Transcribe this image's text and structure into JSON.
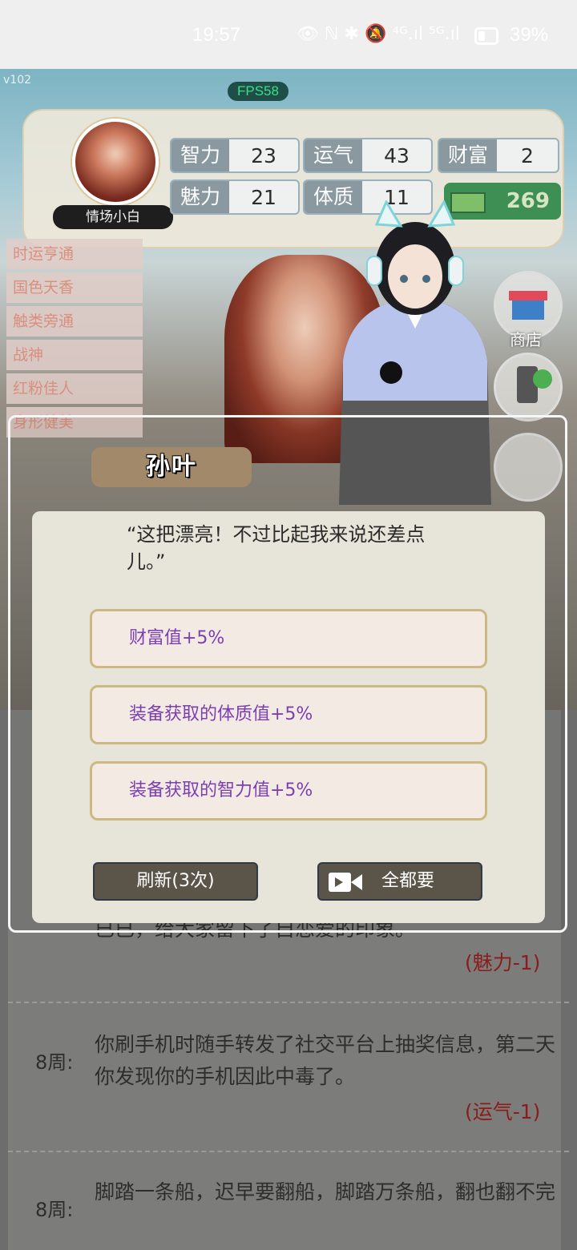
{
  "status_bar": {
    "time": "19:57",
    "icons_text": "👁 ℕ ✱ 🔕 ⁴ᴳ.ıl ⁵ᴳ.ıl",
    "battery_pct": "39%"
  },
  "game": {
    "version": "v102",
    "fps": "FPS58",
    "player_name": "情场小白",
    "stats": [
      {
        "label": "智力",
        "value": "23"
      },
      {
        "label": "运气",
        "value": "43"
      },
      {
        "label": "财富",
        "value": "2"
      },
      {
        "label": "魅力",
        "value": "21"
      },
      {
        "label": "体质",
        "value": "11"
      }
    ],
    "money": "269",
    "titles": [
      "时运亨通",
      "国色天香",
      "触类旁通",
      "战神",
      "红粉佳人",
      "身形健美"
    ],
    "shop_label": "商店"
  },
  "dialog": {
    "speaker": "孙叶",
    "quote": "“这把漂亮！不过比起我来说还差点儿。”",
    "options": [
      "财富值+5%",
      "装备获取的体质值+5%",
      "装备获取的智力值+5%"
    ],
    "refresh_label": "刷新(3次)",
    "take_all_label": "全都要"
  },
  "log": {
    "partial_text_1": "已已，给大家留下了自恋爱的印象。",
    "effect_1": "(魅力-1)",
    "entry_2_week": "8周:",
    "entry_2_text": "你刷手机时随手转发了社交平台上抽奖信息，第二天你发现你的手机因此中毒了。",
    "effect_2": "(运气-1)",
    "entry_3_week": "8周:",
    "entry_3_text": "脚踏一条船，迟早要翻船，脚踏万条船，翻也翻不完"
  },
  "colors": {
    "option_text": "#7b3fb3",
    "effect_text": "#8a1c1c",
    "money_bg": "#3e8f54"
  }
}
